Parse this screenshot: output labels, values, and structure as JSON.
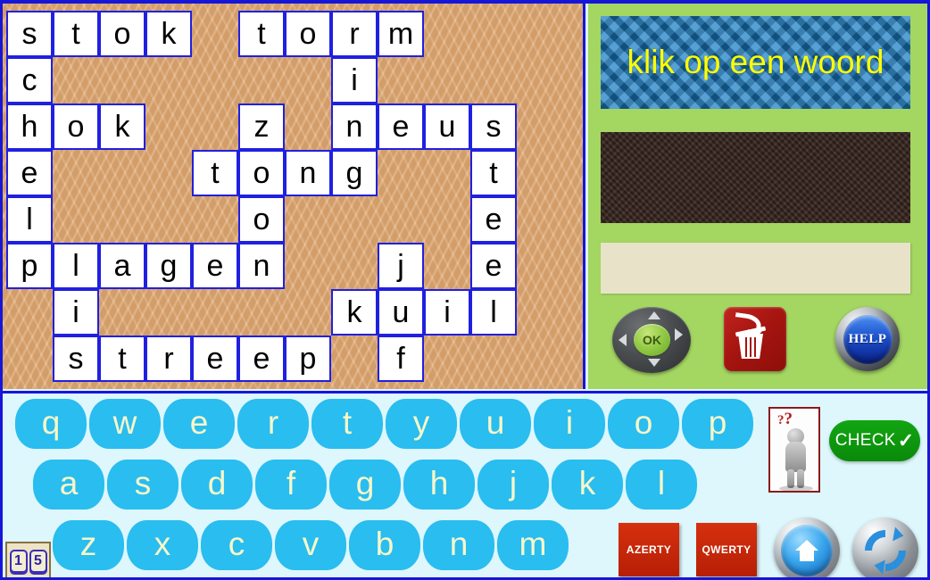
{
  "app": {
    "title": "Crossword Word Game",
    "language": "nl"
  },
  "grid": {
    "cols": 11,
    "rows": 8,
    "cell_size": 52,
    "background_color": "#e0ab76",
    "cell_border_color": "#2020e0",
    "letters": [
      {
        "row": 0,
        "col": 0,
        "letter": "s"
      },
      {
        "row": 0,
        "col": 1,
        "letter": "t"
      },
      {
        "row": 0,
        "col": 2,
        "letter": "o"
      },
      {
        "row": 0,
        "col": 3,
        "letter": "k"
      },
      {
        "row": 0,
        "col": 5,
        "letter": "t"
      },
      {
        "row": 0,
        "col": 6,
        "letter": "o"
      },
      {
        "row": 0,
        "col": 7,
        "letter": "r"
      },
      {
        "row": 0,
        "col": 8,
        "letter": "m"
      },
      {
        "row": 1,
        "col": 0,
        "letter": "c"
      },
      {
        "row": 1,
        "col": 7,
        "letter": "i"
      },
      {
        "row": 2,
        "col": 0,
        "letter": "h"
      },
      {
        "row": 2,
        "col": 1,
        "letter": "o"
      },
      {
        "row": 2,
        "col": 2,
        "letter": "k"
      },
      {
        "row": 2,
        "col": 5,
        "letter": "z"
      },
      {
        "row": 2,
        "col": 7,
        "letter": "n"
      },
      {
        "row": 2,
        "col": 8,
        "letter": "e"
      },
      {
        "row": 2,
        "col": 9,
        "letter": "u"
      },
      {
        "row": 2,
        "col": 10,
        "letter": "s"
      },
      {
        "row": 3,
        "col": 0,
        "letter": "e"
      },
      {
        "row": 3,
        "col": 4,
        "letter": "t"
      },
      {
        "row": 3,
        "col": 5,
        "letter": "o"
      },
      {
        "row": 3,
        "col": 6,
        "letter": "n"
      },
      {
        "row": 3,
        "col": 7,
        "letter": "g"
      },
      {
        "row": 3,
        "col": 10,
        "letter": "t"
      },
      {
        "row": 4,
        "col": 0,
        "letter": "l"
      },
      {
        "row": 4,
        "col": 5,
        "letter": "o"
      },
      {
        "row": 4,
        "col": 10,
        "letter": "e"
      },
      {
        "row": 5,
        "col": 0,
        "letter": "p"
      },
      {
        "row": 5,
        "col": 1,
        "letter": "l"
      },
      {
        "row": 5,
        "col": 2,
        "letter": "a"
      },
      {
        "row": 5,
        "col": 3,
        "letter": "g"
      },
      {
        "row": 5,
        "col": 4,
        "letter": "e"
      },
      {
        "row": 5,
        "col": 5,
        "letter": "n"
      },
      {
        "row": 5,
        "col": 8,
        "letter": "j"
      },
      {
        "row": 5,
        "col": 10,
        "letter": "e"
      },
      {
        "row": 6,
        "col": 1,
        "letter": "i"
      },
      {
        "row": 6,
        "col": 7,
        "letter": "k"
      },
      {
        "row": 6,
        "col": 8,
        "letter": "u"
      },
      {
        "row": 6,
        "col": 9,
        "letter": "i"
      },
      {
        "row": 6,
        "col": 10,
        "letter": "l"
      },
      {
        "row": 7,
        "col": 1,
        "letter": "s"
      },
      {
        "row": 7,
        "col": 2,
        "letter": "t"
      },
      {
        "row": 7,
        "col": 3,
        "letter": "r"
      },
      {
        "row": 7,
        "col": 4,
        "letter": "e"
      },
      {
        "row": 7,
        "col": 5,
        "letter": "e"
      },
      {
        "row": 7,
        "col": 6,
        "letter": "p"
      },
      {
        "row": 7,
        "col": 8,
        "letter": "f"
      }
    ]
  },
  "right_panel": {
    "background_color": "#a4d662",
    "prompt": {
      "text": "klik op een woord",
      "text_color": "#ffff00",
      "background_color": "#1b7ec4"
    },
    "image_box": {
      "background_color": "#3e2b24",
      "content": ""
    },
    "answer_box": {
      "background_color": "#e8e3c8",
      "value": "",
      "placeholder": ""
    },
    "buttons": {
      "ok_label": "OK",
      "trash_label": "",
      "help_label": "HELP"
    }
  },
  "keyboard": {
    "layout_name": "qwerty",
    "key_color": "#29bdf0",
    "key_text_color": "#f7f7c8",
    "rows": [
      [
        "q",
        "w",
        "e",
        "r",
        "t",
        "y",
        "u",
        "i",
        "o",
        "p"
      ],
      [
        "a",
        "s",
        "d",
        "f",
        "g",
        "h",
        "j",
        "k",
        "l"
      ],
      [
        "z",
        "x",
        "c",
        "v",
        "b",
        "n",
        "m"
      ]
    ]
  },
  "controls": {
    "counter": {
      "digits": [
        "1",
        "5"
      ]
    },
    "check": {
      "label": "CHECK",
      "tick": "✓",
      "color": "#0a8a0a"
    },
    "azerty": {
      "label": "AZERTY"
    },
    "qwerty": {
      "label": "QWERTY"
    },
    "home": {
      "label": ""
    },
    "refresh": {
      "label": ""
    },
    "thinker": {
      "question_marks": "? ?"
    }
  }
}
